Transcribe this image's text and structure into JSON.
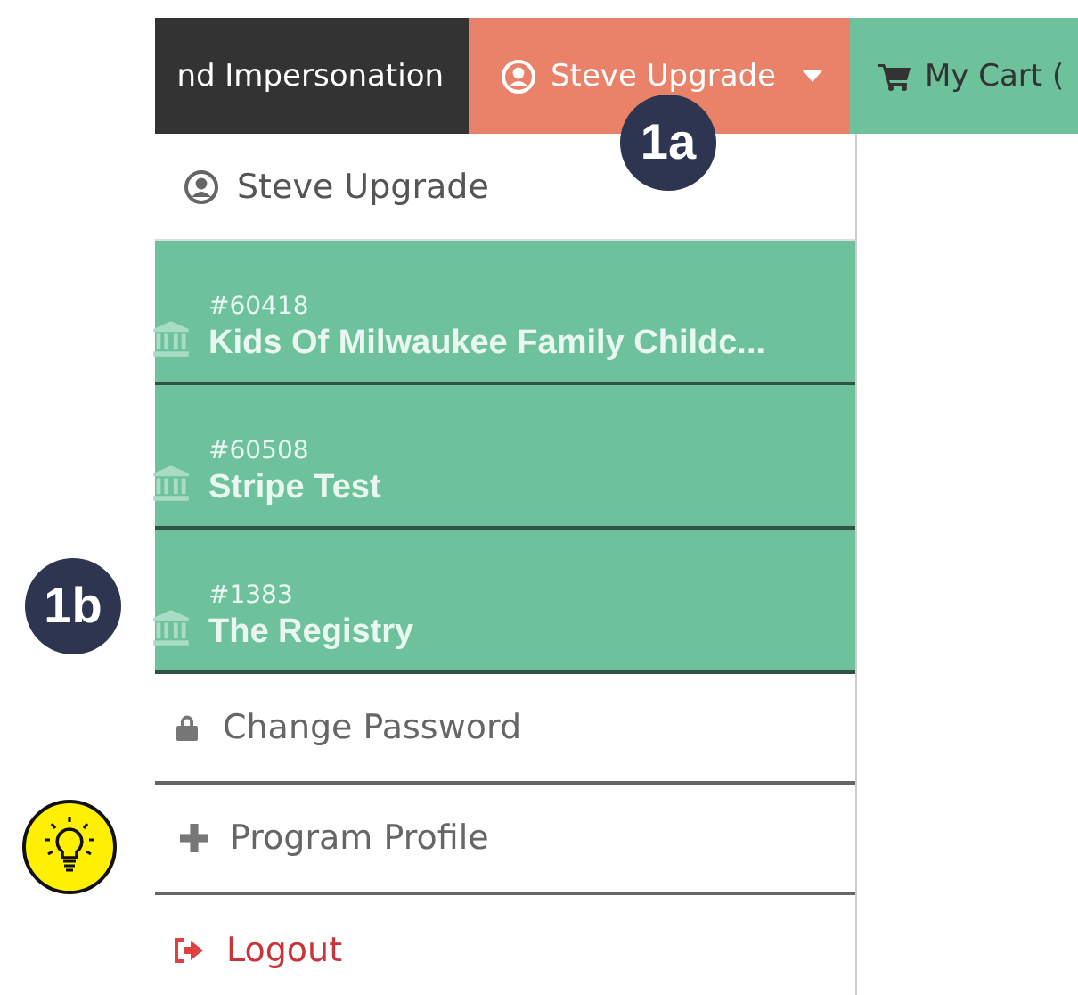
{
  "nav": {
    "impersonation": "nd Impersonation",
    "user_menu": "Steve Upgrade",
    "cart": "My Cart ("
  },
  "menu": {
    "user": "Steve Upgrade",
    "programs": [
      {
        "number": "#60418",
        "name": "Kids Of Milwaukee Family Childc..."
      },
      {
        "number": "#60508",
        "name": "Stripe Test"
      },
      {
        "number": "#1383",
        "name": "The Registry"
      }
    ],
    "actions": [
      {
        "kind": "lock",
        "label": "Change Password"
      },
      {
        "kind": "plus",
        "label": "Program Profile"
      },
      {
        "kind": "logout",
        "label": "Logout"
      }
    ]
  },
  "callouts": [
    {
      "label": "1a"
    },
    {
      "label": "1b"
    }
  ]
}
